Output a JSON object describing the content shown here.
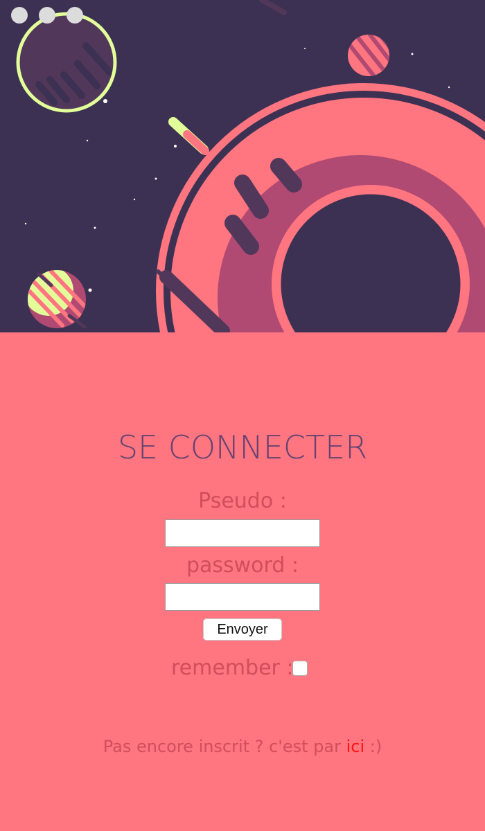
{
  "window": {
    "controls": [
      "close",
      "minimize",
      "zoom"
    ]
  },
  "colors": {
    "background": "#ff7580",
    "hero_background": "#3c3152",
    "title": "#634372",
    "label": "#cf4f5a",
    "link": "#ff1313"
  },
  "hero": {
    "illustration": "space-scene with planets, ring and comets"
  },
  "login": {
    "title": "SE CONNECTER",
    "pseudo_label": "Pseudo :",
    "pseudo_value": "",
    "password_label": "password :",
    "password_value": "",
    "submit_label": "Envoyer",
    "remember_label": "remember :",
    "remember_checked": false
  },
  "footer": {
    "text_before": "Pas encore inscrit ? c'est par ",
    "link_text": "ici",
    "text_after": " :)"
  }
}
